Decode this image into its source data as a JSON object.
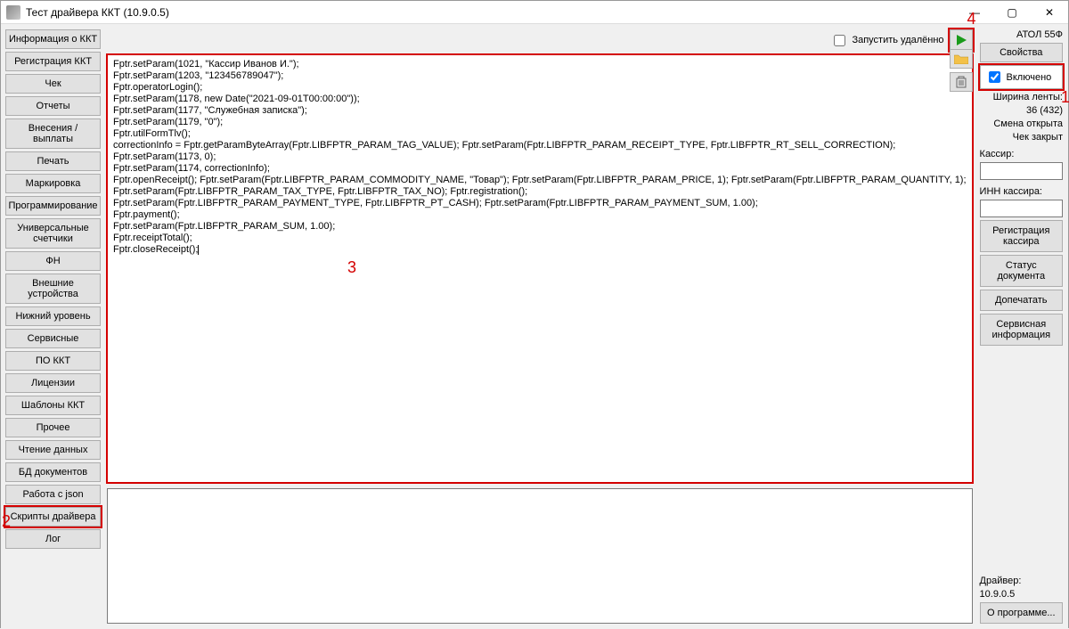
{
  "window": {
    "title": "Тест драйвера ККТ (10.9.0.5)"
  },
  "nav": [
    "Информация о ККТ",
    "Регистрация ККТ",
    "Чек",
    "Отчеты",
    "Внесения / выплаты",
    "Печать",
    "Маркировка",
    "Программирование",
    "Универсальные счетчики",
    "ФН",
    "Внешние устройства",
    "Нижний уровень",
    "Сервисные",
    "ПО ККТ",
    "Лицензии",
    "Шаблоны ККТ",
    "Прочее",
    "Чтение данных",
    "БД документов",
    "Работа с json",
    "Скрипты драйвера",
    "Лог"
  ],
  "nav_selected_index": 20,
  "top": {
    "remote_label": "Запустить удалённо"
  },
  "script": "Fptr.setParam(1021, \"Кассир Иванов И.\");\nFptr.setParam(1203, \"123456789047\");\nFptr.operatorLogin();\nFptr.setParam(1178, new Date(\"2021-09-01T00:00:00\"));\nFptr.setParam(1177, \"Служебная записка\");\nFptr.setParam(1179, \"0\");\nFptr.utilFormTlv();\ncorrectionInfo = Fptr.getParamByteArray(Fptr.LIBFPTR_PARAM_TAG_VALUE); Fptr.setParam(Fptr.LIBFPTR_PARAM_RECEIPT_TYPE, Fptr.LIBFPTR_RT_SELL_CORRECTION);\nFptr.setParam(1173, 0);\nFptr.setParam(1174, correctionInfo);\nFptr.openReceipt(); Fptr.setParam(Fptr.LIBFPTR_PARAM_COMMODITY_NAME, \"Товар\"); Fptr.setParam(Fptr.LIBFPTR_PARAM_PRICE, 1); Fptr.setParam(Fptr.LIBFPTR_PARAM_QUANTITY, 1);\nFptr.setParam(Fptr.LIBFPTR_PARAM_TAX_TYPE, Fptr.LIBFPTR_TAX_NO); Fptr.registration();\nFptr.setParam(Fptr.LIBFPTR_PARAM_PAYMENT_TYPE, Fptr.LIBFPTR_PT_CASH); Fptr.setParam(Fptr.LIBFPTR_PARAM_PAYMENT_SUM, 1.00);\nFptr.payment();\nFptr.setParam(Fptr.LIBFPTR_PARAM_SUM, 1.00);\nFptr.receiptTotal();\nFptr.closeReceipt();",
  "right": {
    "device": "АТОЛ 55Ф",
    "properties_btn": "Свойства",
    "enabled_label": "Включено",
    "tape_label": "Ширина ленты:",
    "tape_value": "36 (432)",
    "shift_status": "Смена открыта",
    "receipt_status": "Чек закрыт",
    "cashier_label": "Кассир:",
    "cashier_value": "",
    "cashier_inn_label": "ИНН кассира:",
    "cashier_inn_value": "",
    "reg_cashier_btn": "Регистрация кассира",
    "doc_status_btn": "Статус документа",
    "reprint_btn": "Допечатать",
    "service_info_btn": "Сервисная информация",
    "driver_label": "Драйвер:",
    "driver_version": "10.9.0.5",
    "about_btn": "О программе..."
  },
  "annotations": {
    "a1": "1",
    "a2": "2",
    "a3": "3",
    "a4": "4"
  }
}
